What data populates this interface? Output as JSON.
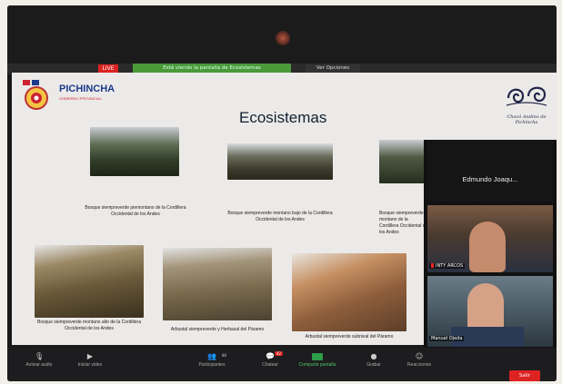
{
  "meeting": {
    "live_badge": "LIVE",
    "share_banner": "Está viendo la pantalla de Ecosistemas",
    "view_options": "Ver Opciones"
  },
  "slide": {
    "brand_name": "PICHINCHA",
    "brand_sub": "GOBIERNO PROVINCIAL",
    "title": "Ecosistemas",
    "right_logo_text": "Chocó Andino de Pichincha",
    "captions": [
      "Bosque siempreverde piemontano de la Cordillera Occidental de los Andes",
      "Bosque siempreverde montano bajo de la Cordillera Occidental de los Andes",
      "Bosque siempreverde montano de la Cordillera Occidental de los Andes",
      "Bosque siempreverde montano alto de la Cordillera Occidental de los Andes",
      "Arbustal siempreverde y Herbazal del Páramo",
      "Arbustal siempreverde subnival del Páramo"
    ]
  },
  "gallery": {
    "tiles": [
      {
        "name": "Edmundo Joaqu..."
      },
      {
        "name": "INTY ARCOS"
      },
      {
        "name": "Manuel Ojeda"
      }
    ]
  },
  "toolbar": {
    "mute": "Activar audio",
    "video": "Iniciar video",
    "participants": "Participantes",
    "participants_count": "80",
    "chat": "Chatear",
    "chat_badge": "42",
    "share": "Compartir pantalla",
    "record": "Grabar",
    "reactions": "Reacciones",
    "leave": "Salir"
  },
  "colors": {
    "brand_blue": "#1a3a8c",
    "accent_red": "#d22222",
    "share_green": "#4a9a3a"
  }
}
